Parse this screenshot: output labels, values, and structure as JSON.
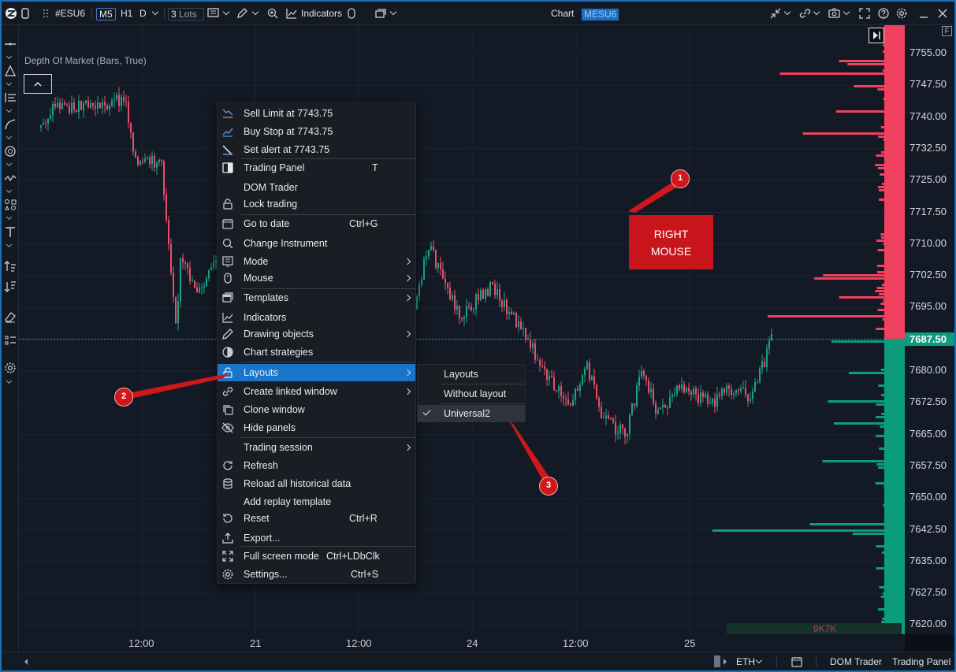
{
  "toolbar": {
    "instrument": "#ESU6",
    "timeframes": [
      "M5",
      "H1",
      "D"
    ],
    "lots_value": "3",
    "lots_label": "Lots",
    "indicators_label": "Indicators",
    "chart_label": "Chart",
    "symbol_badge": "MESU6"
  },
  "chart": {
    "title": "Depth Of Market (Bars, True)",
    "price_labels": [
      "7755.00",
      "7747.50",
      "7740.00",
      "7732.50",
      "7725.00",
      "7717.50",
      "7710.00",
      "7702.50",
      "7695.00",
      "7687.50",
      "7680.00",
      "7672.50",
      "7665.00",
      "7657.50",
      "7650.00",
      "7642.50",
      "7635.00",
      "7627.50",
      "7620.00"
    ],
    "current_price": "7687.50",
    "time_labels": [
      "12:00",
      "21",
      "12:00",
      "24",
      "12:00",
      "25"
    ],
    "volume_label": "9K7K"
  },
  "menu": {
    "items": [
      {
        "label": "Sell Limit at 7743.75",
        "icon": "sell-limit-icon"
      },
      {
        "label": "Buy Stop at 7743.75",
        "icon": "buy-stop-icon"
      },
      {
        "label": "Set alert at 7743.75",
        "icon": "alert-icon"
      },
      {
        "label": "Trading Panel",
        "shortcut": "T",
        "icon": "trading-panel-icon"
      },
      {
        "label": "DOM Trader"
      },
      {
        "label": "Lock trading",
        "icon": "lock-icon"
      },
      {
        "label": "Go to date",
        "shortcut": "Ctrl+G",
        "icon": "calendar-icon"
      },
      {
        "label": "Change Instrument",
        "icon": "search-icon"
      },
      {
        "label": "Mode",
        "icon": "mode-icon"
      },
      {
        "label": "Mouse",
        "icon": "mouse-icon"
      },
      {
        "label": "Templates",
        "icon": "templates-icon"
      },
      {
        "label": "Indicators",
        "icon": "indicators-icon"
      },
      {
        "label": "Drawing objects",
        "icon": "pencil-icon"
      },
      {
        "label": "Chart strategies",
        "icon": "strategies-icon"
      },
      {
        "label": "Layouts",
        "icon": "layouts-icon"
      },
      {
        "label": "Create linked window",
        "icon": "link-icon"
      },
      {
        "label": "Clone window",
        "icon": "clone-icon"
      },
      {
        "label": "Hide panels",
        "icon": "eye-off-icon"
      },
      {
        "label": "Trading session"
      },
      {
        "label": "Refresh",
        "icon": "refresh-icon"
      },
      {
        "label": "Reload all historical data",
        "icon": "database-icon"
      },
      {
        "label": "Add replay template"
      },
      {
        "label": "Reset",
        "shortcut": "Ctrl+R",
        "icon": "reset-icon"
      },
      {
        "label": "Export...",
        "icon": "export-icon"
      },
      {
        "label": "Full screen mode",
        "shortcut": "Ctrl+LDbClk",
        "icon": "fullscreen-icon"
      },
      {
        "label": "Settings...",
        "shortcut": "Ctrl+S",
        "icon": "gear-icon"
      }
    ]
  },
  "submenu": {
    "items": [
      "Layouts",
      "Without layout",
      "Universal2"
    ],
    "selected": "Universal2"
  },
  "annotations": {
    "badge1": "1",
    "badge2": "2",
    "badge3": "3",
    "callout_line1": "RIGHT",
    "callout_line2": "MOUSE"
  },
  "bottombar": {
    "session": "ETH",
    "dom_trader": "DOM Trader",
    "trading_panel": "Trading Panel"
  },
  "colors": {
    "ask": "#f0415f",
    "bid": "#0d9c7e",
    "menu_highlight": "#1875c9",
    "annotation": "#d0171c"
  }
}
